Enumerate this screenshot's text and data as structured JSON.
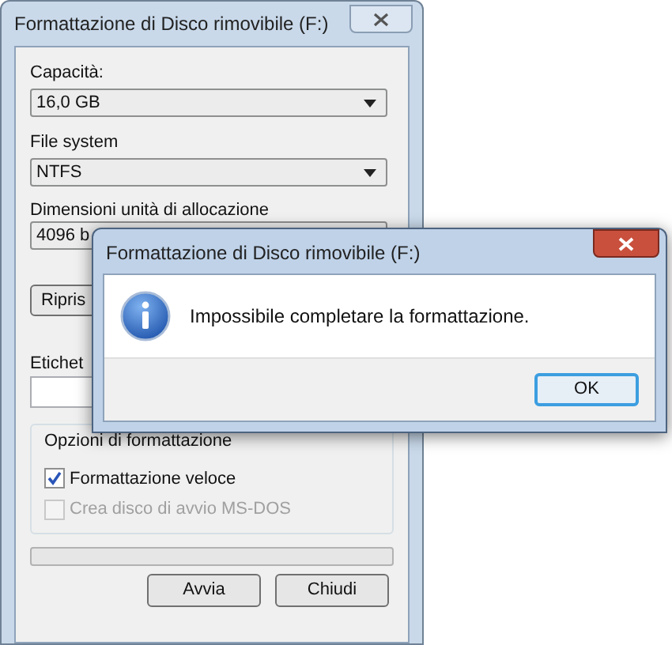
{
  "main_window": {
    "title": "Formattazione di Disco rimovibile (F:)",
    "capacity": {
      "label": "Capacità:",
      "value": "16,0 GB"
    },
    "file_system": {
      "label": "File system",
      "value": "NTFS"
    },
    "allocation": {
      "label": "Dimensioni unità di allocazione",
      "value": "4096 b"
    },
    "restore_button": "Ripris",
    "volume_label": {
      "label": "Etichet"
    },
    "options": {
      "title": "Opzioni di formattazione",
      "items": [
        {
          "label": "Formattazione veloce",
          "checked": true,
          "disabled": false
        },
        {
          "label": "Crea disco di avvio MS-DOS",
          "checked": false,
          "disabled": true
        }
      ]
    },
    "progress": {
      "level": 0
    },
    "buttons": [
      "Avvia",
      "Chiudi"
    ]
  },
  "dialog": {
    "title": "Formattazione di Disco rimovibile (F:)",
    "message": "Impossibile completare la formattazione.",
    "buttons": [
      "OK"
    ]
  }
}
